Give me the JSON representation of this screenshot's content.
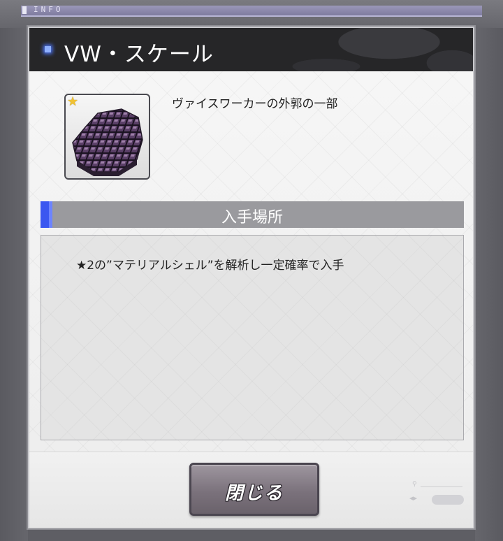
{
  "top_bar": {
    "label": "INFO"
  },
  "dialog": {
    "title": "VW・スケール",
    "item": {
      "description": "ヴァイスワーカーの外郭の一部",
      "rarity_icon": "star-icon",
      "image_icon": "vw-scale-item-icon"
    },
    "source_section": {
      "header": "入手場所",
      "text": "★2の”マテリアルシェル”を解析し一定確率で入手"
    },
    "close_button": {
      "label": "閉じる"
    }
  },
  "colors": {
    "title_bar_bg": "#262628",
    "accent_blue": "#3b57f0",
    "section_header_bg": "#9a9a9e",
    "close_button_bg": "#7b727c",
    "rarity_star": "#f1c232"
  }
}
